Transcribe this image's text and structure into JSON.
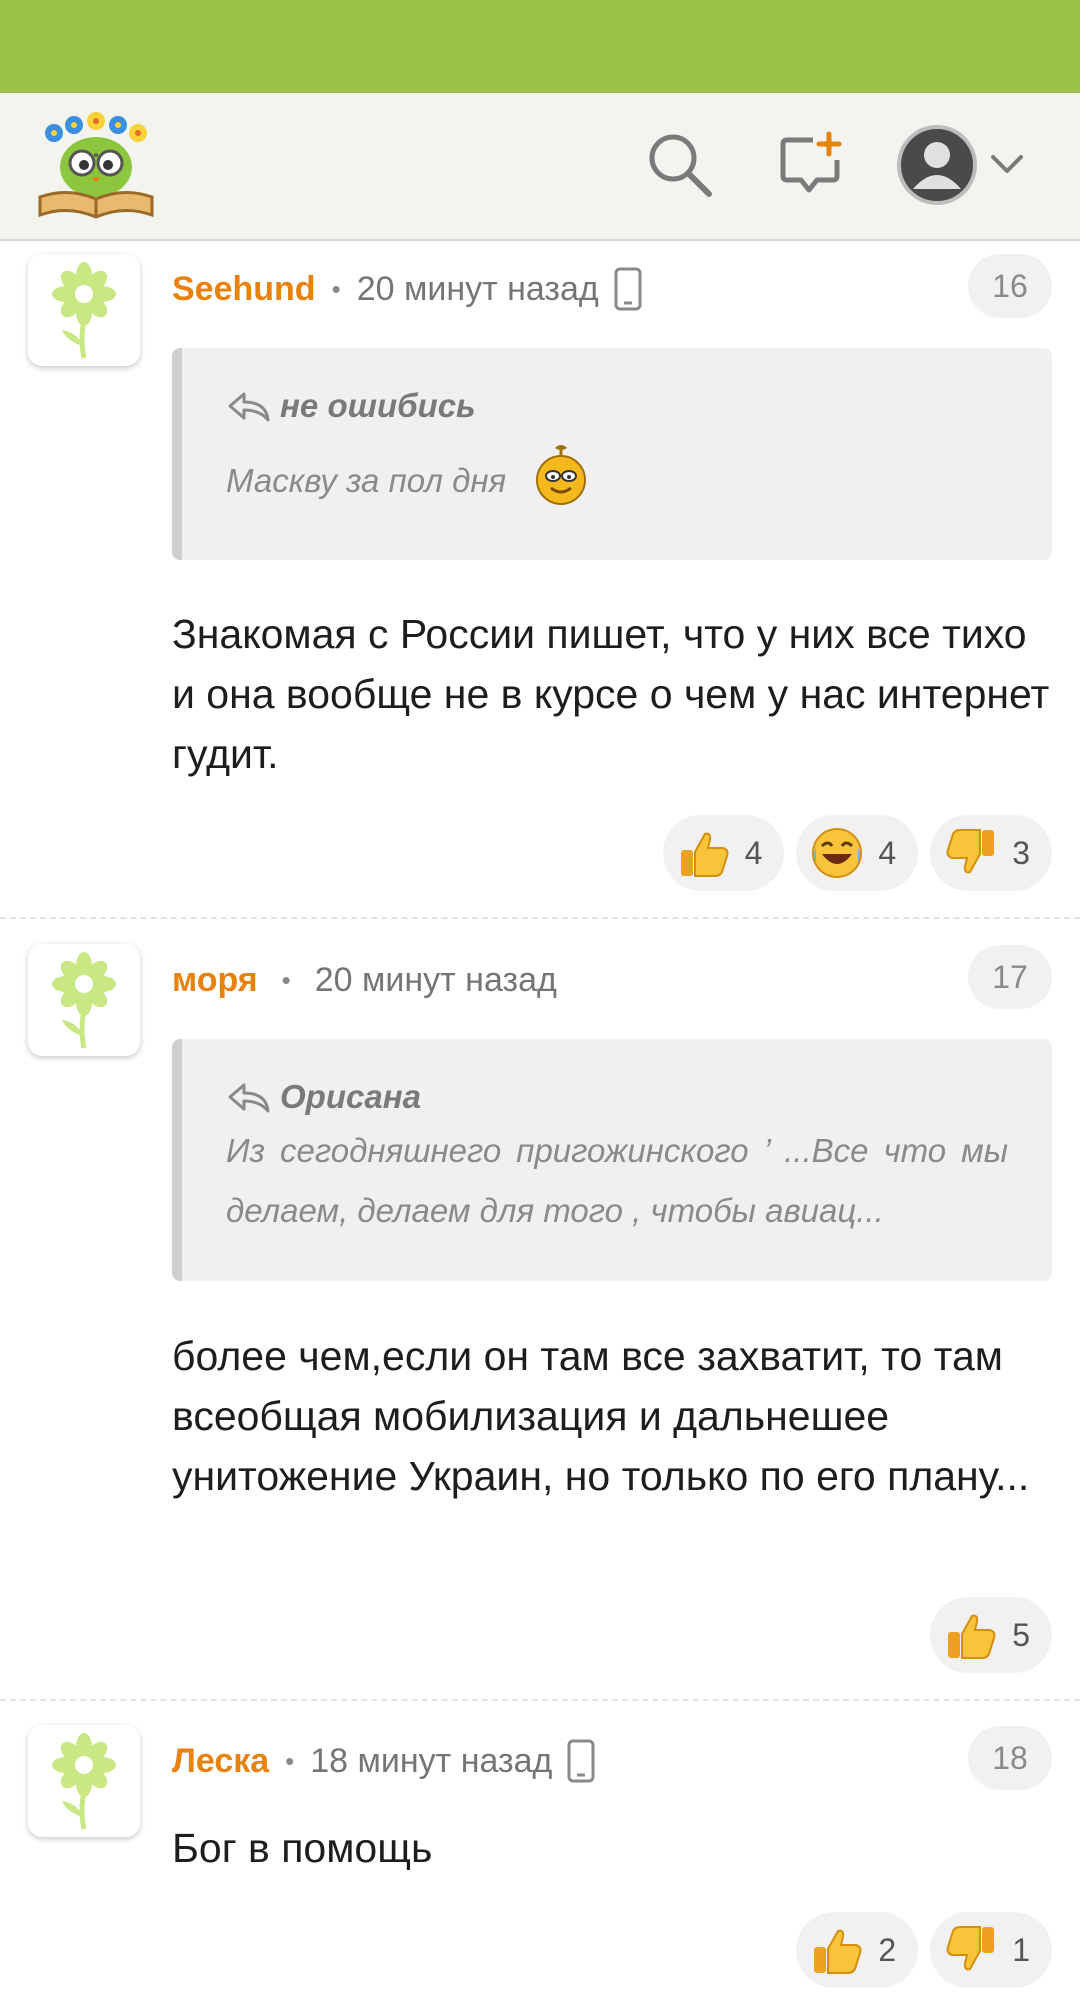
{
  "header": {
    "logo_icon": "owl-on-book-logo",
    "search_icon": "search-icon",
    "new_comment_icon": "new-comment-icon",
    "user_icon": "user-avatar-icon",
    "menu_icon": "chevron-down-icon"
  },
  "colors": {
    "status_bar": "#9bc245",
    "author": "#e8820e",
    "header_bg": "#f4f4ee"
  },
  "comments": [
    {
      "author": "Seehund",
      "time": "20 минут назад",
      "from_mobile": true,
      "number": "16",
      "quote": {
        "author": "не ошибись",
        "text": "Маскву за пол дня"
      },
      "text": "Знакомая с России пишет, что у них все тихо и она вообще не в курсе о чем у нас интернет гудит.",
      "reactions": [
        {
          "icon": "thumbs-up-icon",
          "count": "4"
        },
        {
          "icon": "laughing-face-icon",
          "count": "4"
        },
        {
          "icon": "thumbs-down-icon",
          "count": "3"
        }
      ]
    },
    {
      "author": "моря",
      "time": "20 минут назад",
      "from_mobile": false,
      "number": "17",
      "quote": {
        "author": "Орисана",
        "text": "Из сегодняшнего пригожинского ’ ...Все что мы делаем, делаем для того , чтобы авиац..."
      },
      "text": "более чем,если он там все захватит, то там всеобщая мобилизация и дальнешее унитожение Украин, но только по его плану...",
      "reactions": [
        {
          "icon": "thumbs-up-icon",
          "count": "5"
        }
      ]
    },
    {
      "author": "Леска",
      "time": "18 минут назад",
      "from_mobile": true,
      "number": "18",
      "text": "Бог в помощь",
      "reactions": [
        {
          "icon": "thumbs-up-icon",
          "count": "2"
        },
        {
          "icon": "thumbs-down-icon",
          "count": "1"
        }
      ]
    }
  ]
}
